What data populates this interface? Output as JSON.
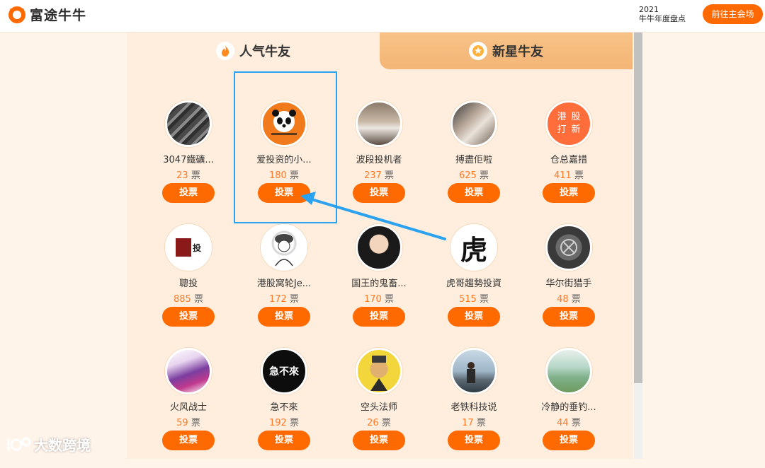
{
  "header": {
    "brand": "富途牛牛",
    "event_year": "2021",
    "event_title": "牛牛年度盘点",
    "main_venue_button": "前往主会场"
  },
  "tabs": [
    {
      "label": "人气牛友",
      "icon": "flame-icon",
      "active": true
    },
    {
      "label": "新星牛友",
      "icon": "star-icon",
      "active": false
    }
  ],
  "vote_label": "投票",
  "vote_unit": "票",
  "users": [
    {
      "name": "3047鐵礦...",
      "votes": "23"
    },
    {
      "name": "爱投资的小...",
      "votes": "180"
    },
    {
      "name": "波段投机者",
      "votes": "237"
    },
    {
      "name": "搏盡佢啦",
      "votes": "625"
    },
    {
      "name": "仓总嘉措",
      "votes": "411"
    },
    {
      "name": "聰投",
      "votes": "885"
    },
    {
      "name": "港股窝轮Je...",
      "votes": "172"
    },
    {
      "name": "国王的鬼畜...",
      "votes": "170"
    },
    {
      "name": "虎哥趨勢投資",
      "votes": "515"
    },
    {
      "name": "华尔街猎手",
      "votes": "48"
    },
    {
      "name": "火风战士",
      "votes": "59"
    },
    {
      "name": "急不來",
      "votes": "192"
    },
    {
      "name": "空头法师",
      "votes": "26"
    },
    {
      "name": "老铁科技说",
      "votes": "17"
    },
    {
      "name": "冷静的垂钓...",
      "votes": "44"
    }
  ],
  "avatar_text": {
    "ipo": [
      "港",
      "股",
      "打",
      "新"
    ],
    "tiger": "虎",
    "jibulai": "急不來",
    "congtou": "投"
  },
  "watermark": "大数跨境",
  "colors": {
    "accent": "#ff6a00",
    "votes": "#ff7a28",
    "panel": "#ffeedd",
    "tab_inactive": "#f3b575",
    "highlight": "#2aa2f0"
  }
}
